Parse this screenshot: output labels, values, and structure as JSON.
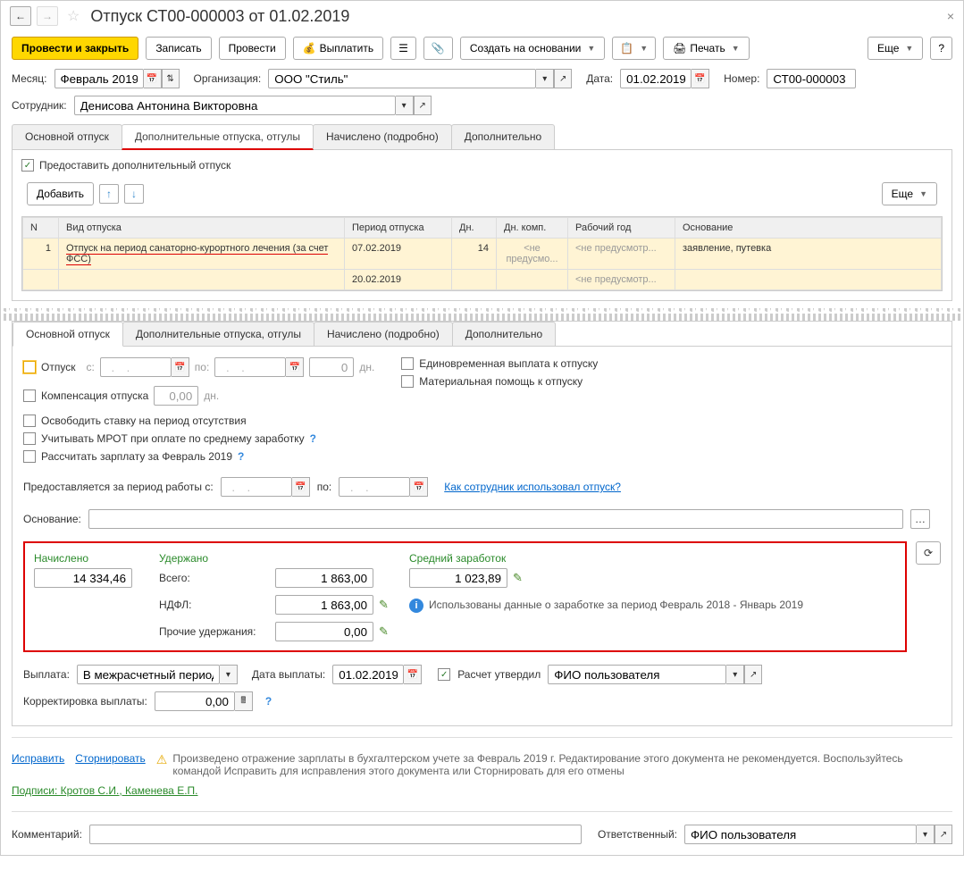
{
  "title": "Отпуск СТ00-000003 от 01.02.2019",
  "toolbar": {
    "submit_close": "Провести и закрыть",
    "save": "Записать",
    "submit": "Провести",
    "pay": "Выплатить",
    "create_based": "Создать на основании",
    "print": "Печать",
    "more": "Еще"
  },
  "header": {
    "month_label": "Месяц:",
    "month_value": "Февраль 2019",
    "org_label": "Организация:",
    "org_value": "ООО \"Стиль\"",
    "date_label": "Дата:",
    "date_value": "01.02.2019",
    "number_label": "Номер:",
    "number_value": "СТ00-000003",
    "employee_label": "Сотрудник:",
    "employee_value": "Денисова Антонина Викторовна"
  },
  "tabs1": {
    "main": "Основной отпуск",
    "extra": "Дополнительные отпуска, отгулы",
    "accrued": "Начислено (подробно)",
    "additional": "Дополнительно"
  },
  "extra_panel": {
    "grant_checkbox": "Предоставить дополнительный отпуск",
    "add_btn": "Добавить",
    "more": "Еще",
    "cols": {
      "n": "N",
      "type": "Вид отпуска",
      "period": "Период отпуска",
      "days": "Дн.",
      "days_comp": "Дн. комп.",
      "work_year": "Рабочий год",
      "basis": "Основание"
    },
    "row": {
      "n": "1",
      "type": "Отпуск на период санаторно-курортного лечения (за счет ФСС)",
      "period_from": "07.02.2019",
      "period_to": "20.02.2019",
      "days": "14",
      "days_comp": "<не предусмо...",
      "work_year1": "<не предусмотр...",
      "work_year2": "<не предусмотр...",
      "basis": "заявление, путевка"
    }
  },
  "tabs2": {
    "main": "Основной отпуск",
    "extra": "Дополнительные отпуска, отгулы",
    "accrued": "Начислено (подробно)",
    "additional": "Дополнительно"
  },
  "main_panel": {
    "vacation_label": "Отпуск",
    "from": "с:",
    "to": "по:",
    "days_value": "0",
    "days_unit": "дн.",
    "lump_sum": "Единовременная выплата к отпуску",
    "material_aid": "Материальная помощь к отпуску",
    "compensation": "Компенсация отпуска",
    "comp_value": "0,00",
    "comp_unit": "дн.",
    "release_rate": "Освободить ставку на период отсутствия",
    "mrot": "Учитывать МРОТ при оплате по среднему заработку",
    "calc_salary": "Рассчитать зарплату за Февраль 2019",
    "period_label": "Предоставляется за период работы с:",
    "period_to": "по:",
    "usage_link": "Как сотрудник использовал отпуск?",
    "basis_label": "Основание:"
  },
  "totals": {
    "accrued_label": "Начислено",
    "accrued_value": "14 334,46",
    "withheld_label": "Удержано",
    "total_label": "Всего:",
    "total_value": "1 863,00",
    "ndfl_label": "НДФЛ:",
    "ndfl_value": "1 863,00",
    "other_label": "Прочие удержания:",
    "other_value": "0,00",
    "avg_label": "Средний заработок",
    "avg_value": "1 023,89",
    "info_text": "Использованы данные о заработке за период Февраль 2018 - Январь 2019"
  },
  "payment": {
    "label": "Выплата:",
    "value": "В межрасчетный период",
    "date_label": "Дата выплаты:",
    "date_value": "01.02.2019",
    "approved_label": "Расчет утвердил",
    "approved_value": "ФИО пользователя",
    "correction_label": "Корректировка выплаты:",
    "correction_value": "0,00"
  },
  "footer": {
    "fix_link": "Исправить",
    "reverse_link": "Сторнировать",
    "warning_text": "Произведено отражение зарплаты в бухгалтерском учете за Февраль 2019 г. Редактирование этого документа не рекомендуется. Воспользуйтесь командой Исправить для исправления этого документа или Сторнировать для его отмены",
    "signatures": "Подписи: Кротов С.И., Каменева Е.П.",
    "comment_label": "Комментарий:",
    "responsible_label": "Ответственный:",
    "responsible_value": "ФИО пользователя"
  }
}
